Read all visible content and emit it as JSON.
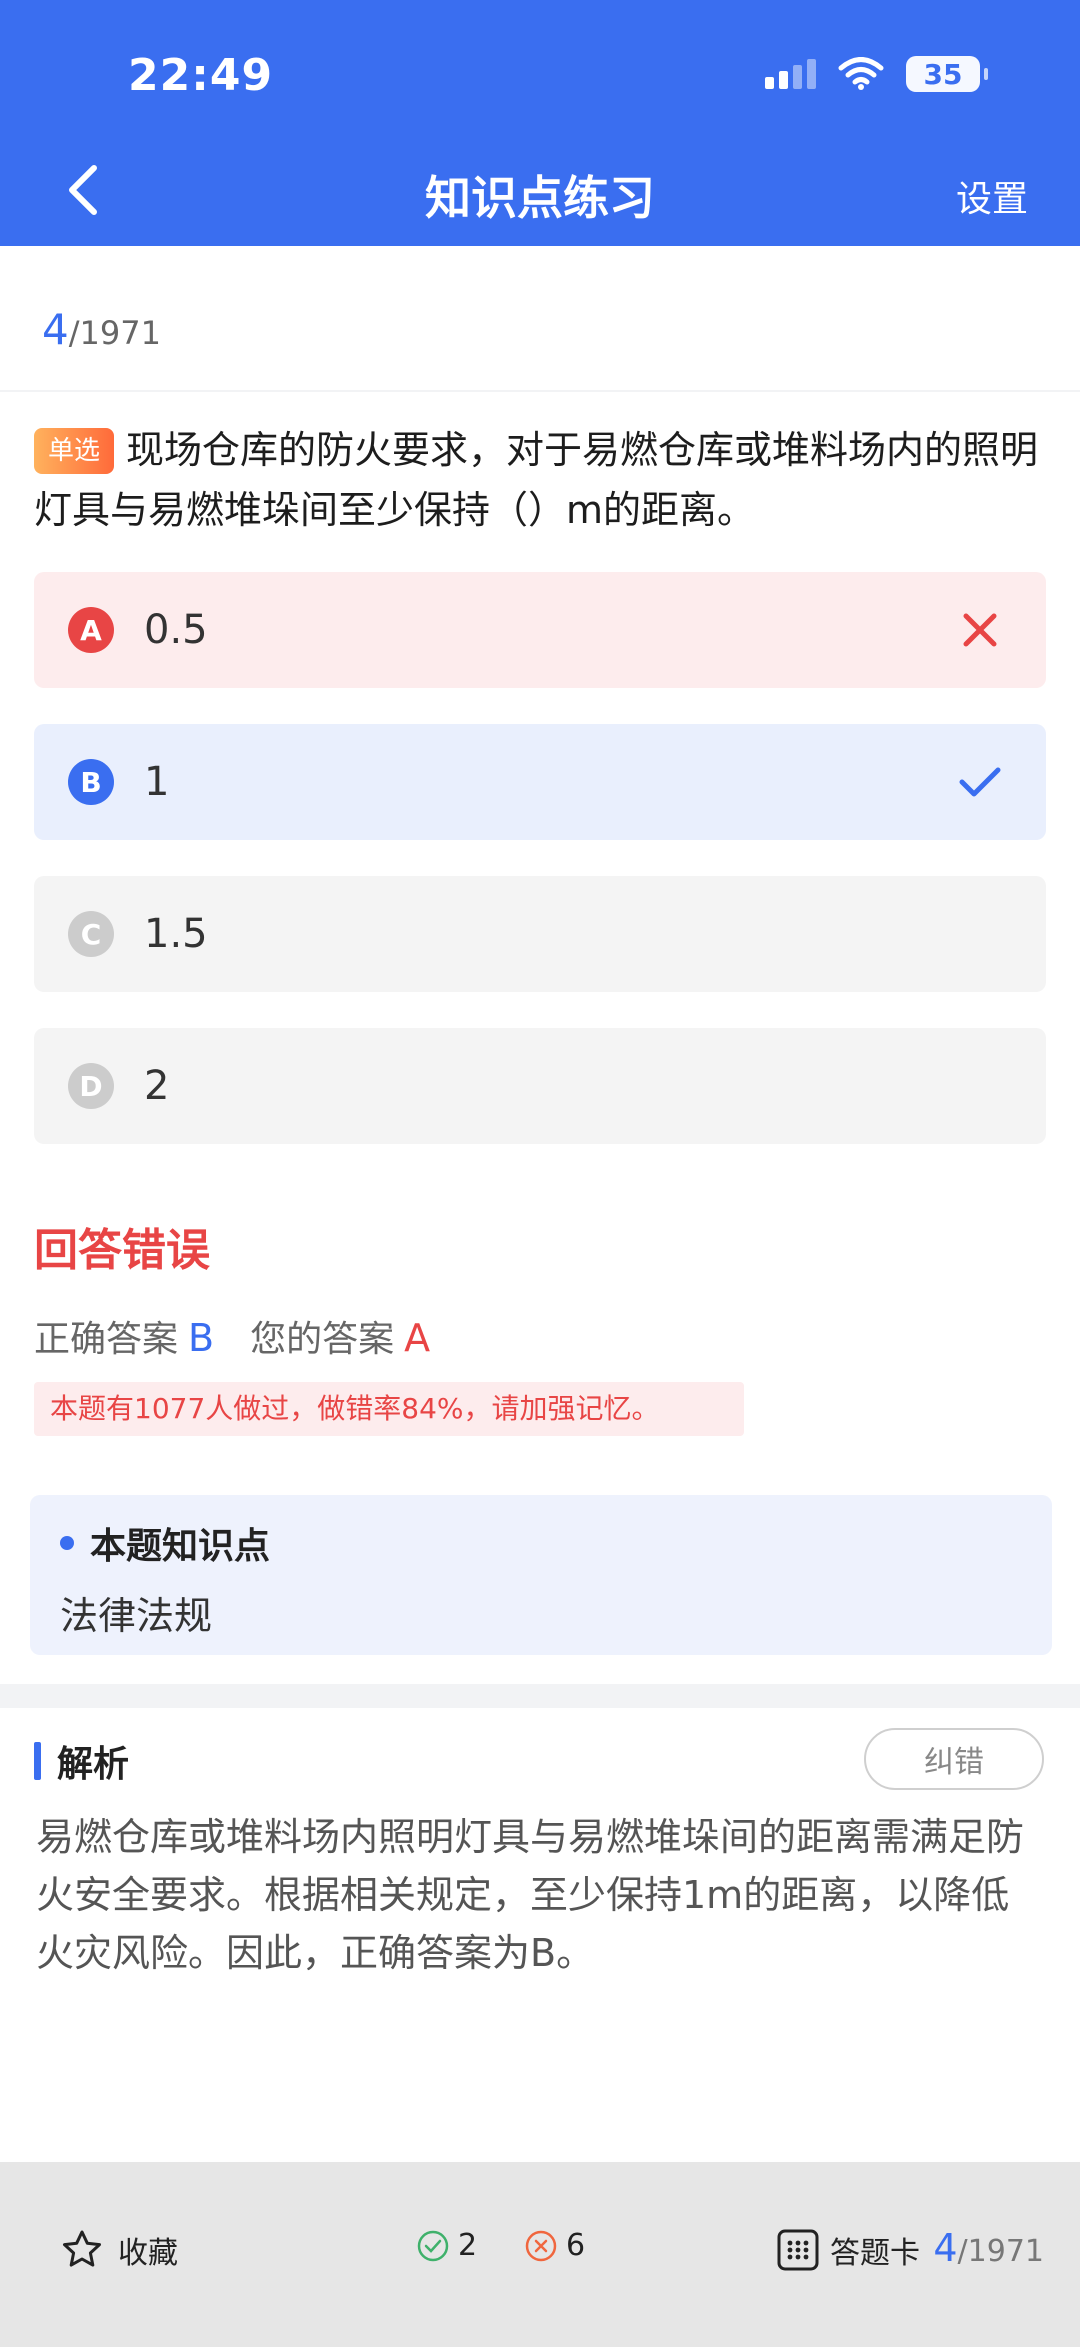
{
  "status_bar": {
    "time": "22:49",
    "battery": "35"
  },
  "header": {
    "title": "知识点练习",
    "settings_label": "设置"
  },
  "progress": {
    "current": "4",
    "total": "/1971"
  },
  "question": {
    "type_tag": "单选",
    "text": "现场仓库的防火要求，对于易燃仓库或堆料场内的照明灯具与易燃堆垛间至少保持（）m的距离。"
  },
  "options": [
    {
      "letter": "A",
      "text": "0.5",
      "state": "wrong"
    },
    {
      "letter": "B",
      "text": "1",
      "state": "correct"
    },
    {
      "letter": "C",
      "text": "1.5",
      "state": "normal"
    },
    {
      "letter": "D",
      "text": "2",
      "state": "normal"
    }
  ],
  "result": {
    "title": "回答错误",
    "correct_label": "正确答案",
    "correct_value": "B",
    "yours_label": "您的答案",
    "yours_value": "A",
    "stat_note": "本题有1077人做过，做错率84%，请加强记忆。"
  },
  "knowledge": {
    "title": "本题知识点",
    "value": "法律法规"
  },
  "analysis": {
    "title": "解析",
    "report_label": "纠错",
    "text": "易燃仓库或堆料场内照明灯具与易燃堆垛间的距离需满足防火安全要求。根据相关规定，至少保持1m的距离，以降低火灾风险。因此，正确答案为B。"
  },
  "footer": {
    "favorite_label": "收藏",
    "correct_count": "2",
    "wrong_count": "6",
    "card_label": "答题卡",
    "progress_current": "4",
    "progress_total": "/1971"
  },
  "colors": {
    "primary": "#3a6ef0",
    "error": "#e84545",
    "success": "#3fb16b",
    "tag": "#ff7a3d"
  }
}
